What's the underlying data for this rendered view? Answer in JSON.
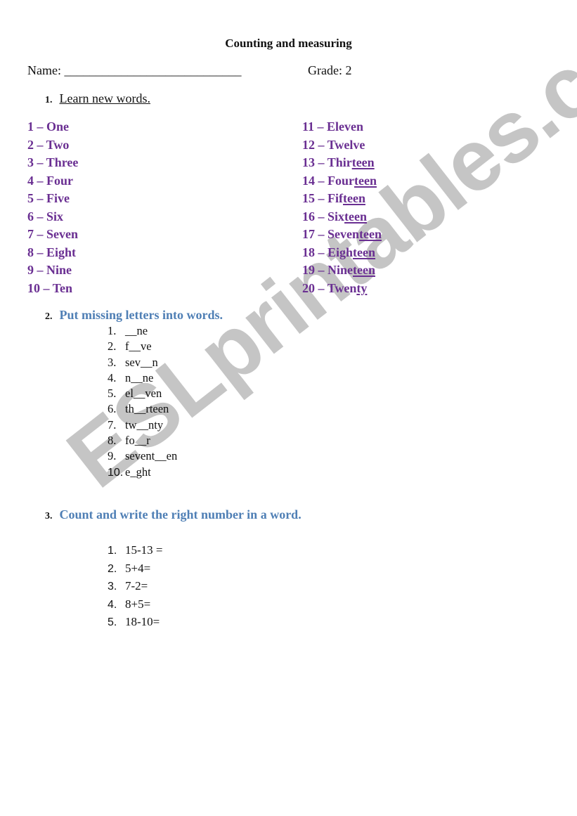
{
  "title": "Counting and measuring",
  "header": {
    "name_label": "Name: ",
    "name_blank": "____________________________",
    "grade_label": "Grade: 2"
  },
  "section1": {
    "number": "1.",
    "label": "Learn new words.",
    "left_column": [
      {
        "num": "1 – ",
        "word": "One",
        "underlined": ""
      },
      {
        "num": "2 – ",
        "word": "Two",
        "underlined": ""
      },
      {
        "num": "3 – ",
        "word": "Three",
        "underlined": ""
      },
      {
        "num": "4 – ",
        "word": "Four",
        "underlined": ""
      },
      {
        "num": "5 – ",
        "word": "Five",
        "underlined": ""
      },
      {
        "num": "6 – ",
        "word": "Six",
        "underlined": ""
      },
      {
        "num": "7 – ",
        "word": "Seven",
        "underlined": ""
      },
      {
        "num": "8 – ",
        "word": "Eight",
        "underlined": ""
      },
      {
        "num": "9 – ",
        "word": "Nine",
        "underlined": ""
      },
      {
        "num": "10 – ",
        "word": "Ten",
        "underlined": ""
      }
    ],
    "right_column": [
      {
        "num": "11 – ",
        "word": "Eleven",
        "underlined": ""
      },
      {
        "num": "12 – ",
        "word": "Twelve",
        "underlined": ""
      },
      {
        "num": "13 – ",
        "word": "Thir",
        "underlined": "teen"
      },
      {
        "num": "14 – ",
        "word": "Four",
        "underlined": "teen"
      },
      {
        "num": "15 – ",
        "word": "Fif",
        "underlined": "teen"
      },
      {
        "num": "16 – ",
        "word": "Six",
        "underlined": "teen"
      },
      {
        "num": "17 – ",
        "word": "Seven",
        "underlined": "teen"
      },
      {
        "num": "18 – ",
        "word": "Eigh",
        "underlined": "teen"
      },
      {
        "num": "19 – ",
        "word": "Nine",
        "underlined": "teen"
      },
      {
        "num": "20 – ",
        "word": "Twen",
        "underlined": "ty"
      }
    ]
  },
  "section2": {
    "number": "2.",
    "label": "Put missing letters into words.",
    "items": [
      {
        "n": "1.",
        "text": "__ne"
      },
      {
        "n": "2.",
        "text": "f__ve"
      },
      {
        "n": "3.",
        "text": "sev__n"
      },
      {
        "n": "4.",
        "text": "n__ne"
      },
      {
        "n": "5.",
        "text": "el__ven"
      },
      {
        "n": "6.",
        "text": "th__rteen"
      },
      {
        "n": "7.",
        "text": "tw__nty"
      },
      {
        "n": "8.",
        "text": "fo__r"
      },
      {
        "n": "9.",
        "text": "sevent__en"
      },
      {
        "n": "10.",
        "text": "e_ght"
      }
    ]
  },
  "section3": {
    "number": "3.",
    "label": "Count and write the right number in a word.",
    "items": [
      {
        "n": "1.",
        "text": "15-13 ="
      },
      {
        "n": "2.",
        "text": "5+4="
      },
      {
        "n": "3.",
        "text": "7-2="
      },
      {
        "n": "4.",
        "text": "8+5="
      },
      {
        "n": "5.",
        "text": "18-10="
      }
    ]
  },
  "watermark": "ESLprintables.com",
  "colors": {
    "word_purple": "#6a2f92",
    "instruction_blue": "#4f7fb5",
    "watermark_gray": "#969696"
  }
}
